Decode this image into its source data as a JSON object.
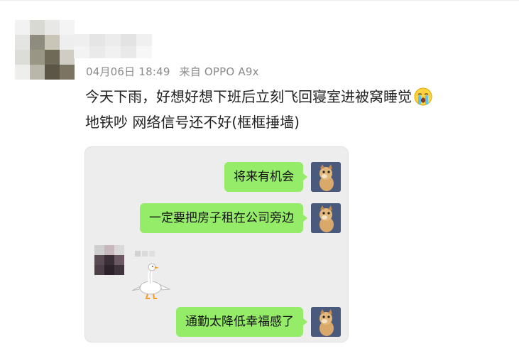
{
  "post": {
    "meta": {
      "datetime": "04月06日 18:49",
      "source": "来自 OPPO A9x"
    },
    "text_line1": "今天下雨，好想好想下班后立刻飞回寝室进被窝睡觉",
    "text_line2": "地铁吵 网络信号还不好(框框捶墙)",
    "emoji": "crying-face-icon"
  },
  "chat": {
    "messages": [
      {
        "side": "right",
        "text": "将来有机会"
      },
      {
        "side": "right",
        "text": "一定要把房子租在公司旁边"
      },
      {
        "side": "left",
        "sticker": "goose-sticker"
      },
      {
        "side": "right",
        "text": "通勤太降低幸福感了"
      }
    ]
  },
  "colors": {
    "bubble_green": "#95ec69",
    "chat_bg": "#ededed",
    "meta_gray": "#8a8a8a"
  }
}
